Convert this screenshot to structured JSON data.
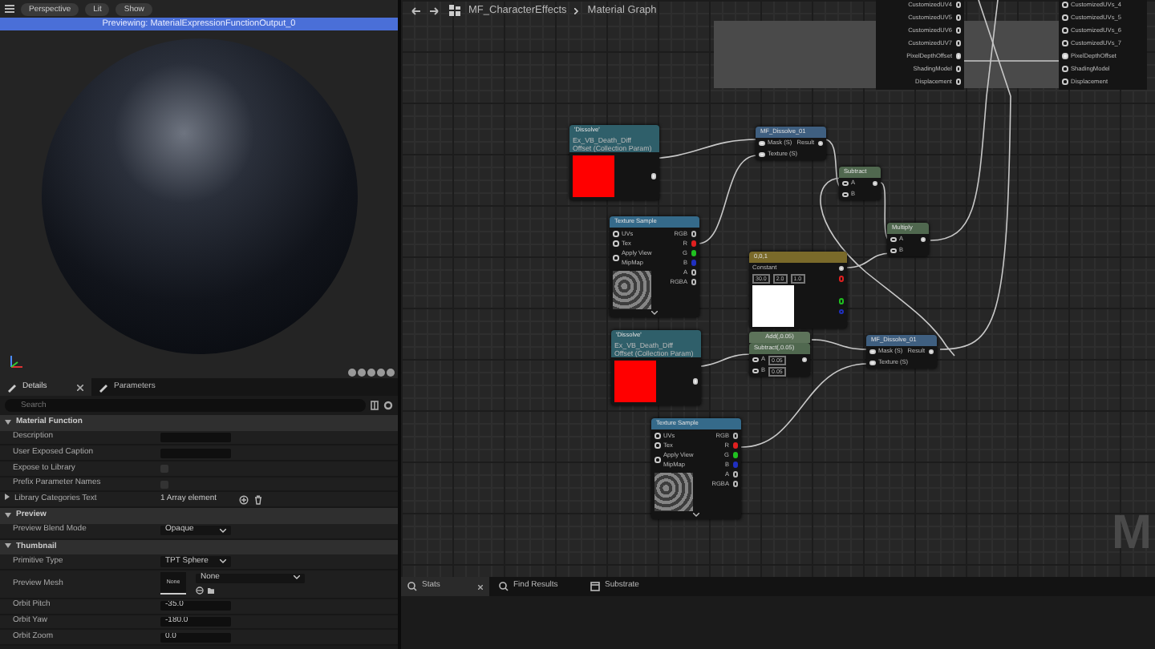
{
  "viewport": {
    "toolbar": [
      {
        "kind": "menu"
      },
      {
        "kind": "button",
        "label": "Perspective"
      },
      {
        "kind": "button",
        "label": "Lit"
      },
      {
        "kind": "button",
        "label": "Show"
      }
    ],
    "banner": "Previewing: MaterialExpressionFunctionOutput_0"
  },
  "details": {
    "tabs": [
      {
        "label": "Details",
        "selected": true
      },
      {
        "label": "Parameters",
        "selected": false
      }
    ],
    "search": {
      "placeholder": "Search"
    },
    "sections": [
      {
        "title": "Material Function",
        "expanded": true,
        "rows": [
          {
            "kind": "text",
            "label": "Description"
          },
          {
            "kind": "text",
            "label": "User Exposed Caption"
          },
          {
            "kind": "checkbox",
            "label": "Expose to Library",
            "checked": false
          },
          {
            "kind": "checkbox",
            "label": "Prefix Parameter Names",
            "checked": false
          },
          {
            "kind": "array",
            "label": "Library Categories Text",
            "value": "1 Array element",
            "expanded": false
          }
        ]
      },
      {
        "title": "Preview",
        "expanded": true,
        "rows": [
          {
            "kind": "dropdown",
            "label": "Preview Blend Mode",
            "value": "Opaque"
          }
        ]
      },
      {
        "title": "Thumbnail",
        "expanded": true,
        "rows": [
          {
            "kind": "dropdown",
            "label": "Primitive Type",
            "value": "TPT Sphere"
          },
          {
            "kind": "mesh",
            "label": "Preview Mesh",
            "thumbnail": "None",
            "value": "None"
          },
          {
            "kind": "number",
            "label": "Orbit Pitch",
            "value": "-35.0"
          },
          {
            "kind": "number",
            "label": "Orbit Yaw",
            "value": "-180.0"
          },
          {
            "kind": "number",
            "label": "Orbit Zoom",
            "value": "0.0"
          }
        ]
      }
    ]
  },
  "graph": {
    "breadcrumb": {
      "asset": "MF_CharacterEffects",
      "graph": "Material Graph"
    },
    "output_pins": {
      "left": [
        "CustomizedUV4",
        "CustomizedUV5",
        "CustomizedUV6",
        "CustomizedUV7",
        "PixelDepthOffset",
        "ShadingModel",
        "Displacement"
      ],
      "right": [
        "CustomizedUVs_4",
        "CustomizedUVs_5",
        "CustomizedUVs_6",
        "CustomizedUVs_7",
        "PixelDepthOffset",
        "ShadingModel",
        "Displacement"
      ]
    },
    "nodes": [
      {
        "kind": "parameter",
        "title": "'Dissolve'",
        "subtitle": [
          "Ex_VB_Death_Diff",
          "Offset (Collection Param)"
        ]
      },
      {
        "kind": "function",
        "title": "MF_Dissolve_01",
        "inputs": [
          "Mask (S)",
          "Texture (S)"
        ],
        "outputs": [
          "Result"
        ]
      },
      {
        "kind": "math",
        "title": "Subtract",
        "inputs": [
          "A",
          "B"
        ]
      },
      {
        "kind": "texture",
        "title": "Texture Sample",
        "inputs": [
          "UVs",
          "Tex",
          "Apply View MipMap"
        ],
        "outputs": [
          "RGB",
          "R",
          "G",
          "B",
          "A",
          "RGBA"
        ]
      },
      {
        "kind": "math",
        "title": "Multiply",
        "inputs": [
          "A",
          "B"
        ]
      },
      {
        "kind": "constant",
        "title": "0,0,1",
        "label": "Constant",
        "values": [
          "30.0",
          "2.0",
          "1.0"
        ]
      },
      {
        "kind": "parameter",
        "title": "'Dissolve'",
        "subtitle": [
          "Ex_VB_Death_Diff",
          "Offset (Collection Param)"
        ]
      },
      {
        "kind": "math",
        "caption": "Add(,0.05)",
        "title": "Subtract(,0.05)",
        "inputs": [
          "A",
          "B"
        ],
        "values": [
          "0.05",
          "0.05"
        ]
      },
      {
        "kind": "function",
        "title": "MF_Dissolve_01",
        "inputs": [
          "Mask (S)",
          "Texture (S)"
        ],
        "outputs": [
          "Result"
        ]
      },
      {
        "kind": "texture",
        "title": "Texture Sample",
        "inputs": [
          "UVs",
          "Tex",
          "Apply View MipMap"
        ],
        "outputs": [
          "RGB",
          "R",
          "G",
          "B",
          "A",
          "RGBA"
        ]
      }
    ],
    "canvas_label": "M",
    "bottom_tabs": [
      {
        "label": "Stats",
        "selected": true
      },
      {
        "label": "Find Results",
        "selected": false
      },
      {
        "label": "Substrate",
        "selected": false
      }
    ]
  }
}
